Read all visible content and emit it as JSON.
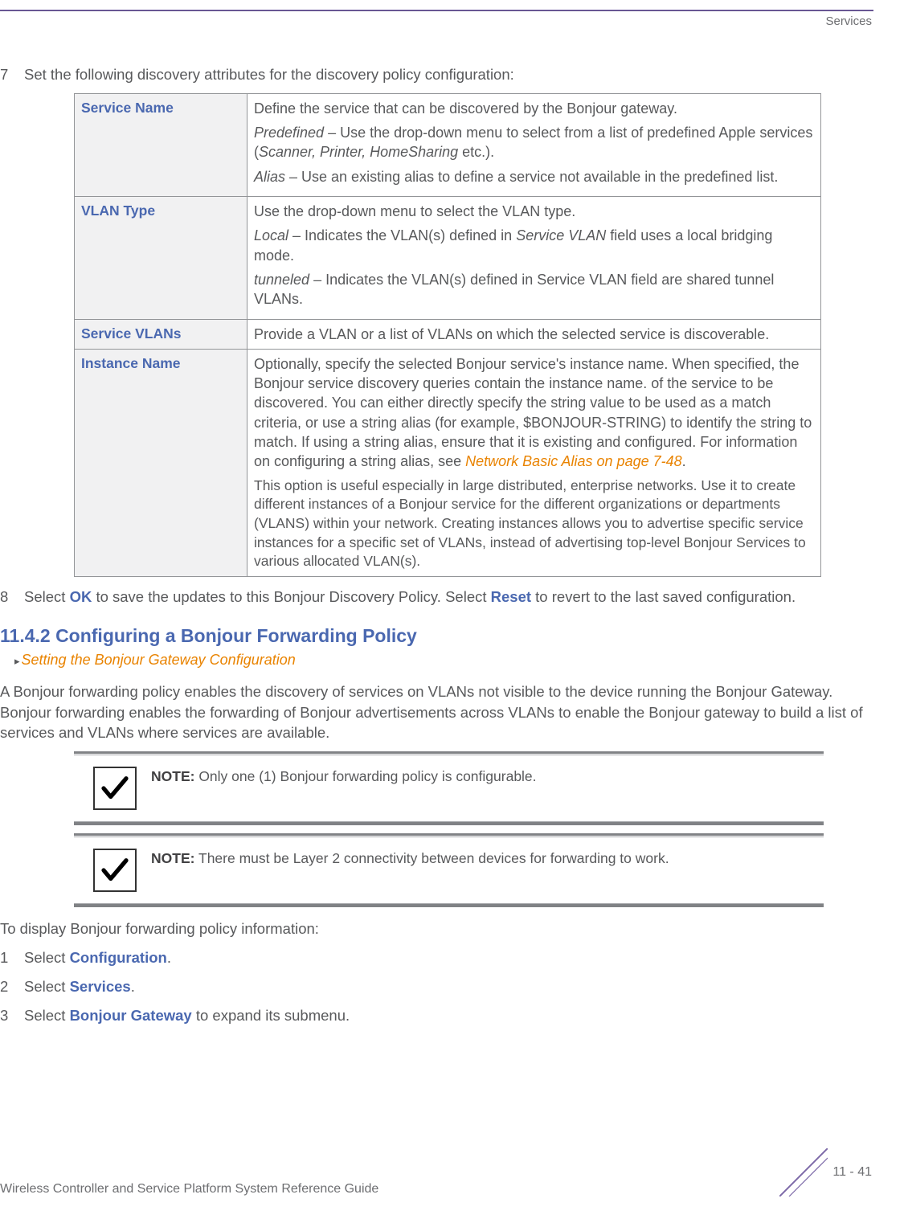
{
  "header": {
    "section": "Services"
  },
  "step7": {
    "num": "7",
    "text": "Set the following discovery attributes for the discovery policy configuration:"
  },
  "table": {
    "rows": [
      {
        "label": "Service Name",
        "p1_a": "Define the service that can be discovered by the Bonjour gateway.",
        "p2_em": "Predefined",
        "p2_rest": " – Use the drop-down menu to select from a list of predefined Apple services (",
        "p2_em2": "Scanner, Printer, HomeSharing",
        "p2_rest2": " etc.).",
        "p3_em": "Alias",
        "p3_rest": " – Use an existing alias to define a service not available in the predefined list."
      },
      {
        "label": "VLAN Type",
        "p1_a": "Use the drop-down menu to select the VLAN type.",
        "p2_em": "Local",
        "p2_rest": " – Indicates the VLAN(s) defined in ",
        "p2_em2": "Service VLAN",
        "p2_rest2": " field uses a local bridging mode.",
        "p3_em": "tunneled",
        "p3_rest": " – Indicates the VLAN(s) defined in Service VLAN field are shared tunnel VLANs."
      },
      {
        "label": "Service VLANs",
        "p1_a": "Provide a VLAN or a list of VLANs on which the selected service is discoverable."
      },
      {
        "label": "Instance Name",
        "p1_a": "Optionally, specify the selected Bonjour service's instance name. When specified, the Bonjour service discovery queries contain the instance name. of the service to be discovered. You can either directly specify the string value to be used as a match criteria, or use a string alias (for example, $BONJOUR-STRING) to identify the string to match. If using a string alias, ensure that it is existing and configured. For information on configuring a string alias, see ",
        "p1_link": "Network Basic Alias on page 7-48",
        "p1_b": ".",
        "p2": "This option is useful especially in large distributed, enterprise networks. Use it to create different instances of a Bonjour service for the different organizations or departments (VLANS) within your network. Creating instances allows you to advertise specific service instances for a specific set of VLANs, instead of advertising top-level Bonjour Services to various allocated VLAN(s)."
      }
    ]
  },
  "step8": {
    "num": "8",
    "t1": "Select ",
    "ok": "OK",
    "t2": " to save the updates to this Bonjour Discovery Policy. Select ",
    "reset": "Reset",
    "t3": " to revert to the last saved configuration."
  },
  "heading": "11.4.2 Configuring a Bonjour Forwarding Policy",
  "breadcrumb": "Setting the Bonjour Gateway Configuration",
  "para": "A Bonjour forwarding policy enables the discovery of services on VLANs not visible to the device running the Bonjour Gateway. Bonjour forwarding enables the forwarding of Bonjour advertisements across VLANs to enable the Bonjour gateway to build a list of services and VLANs where services are available.",
  "note1": {
    "label": "NOTE:",
    "text": " Only one (1) Bonjour forwarding policy is configurable."
  },
  "note2": {
    "label": "NOTE:",
    "text": " There must be Layer 2 connectivity between devices for forwarding to work."
  },
  "para2": "To display Bonjour forwarding policy information:",
  "steps": [
    {
      "num": "1",
      "pre": "Select ",
      "bold": "Configuration",
      "post": "."
    },
    {
      "num": "2",
      "pre": "Select ",
      "bold": "Services",
      "post": "."
    },
    {
      "num": "3",
      "pre": "Select ",
      "bold": "Bonjour Gateway",
      "post": " to expand its submenu."
    }
  ],
  "footer": {
    "left": "Wireless Controller and Service Platform System Reference Guide",
    "right": "11 - 41"
  }
}
